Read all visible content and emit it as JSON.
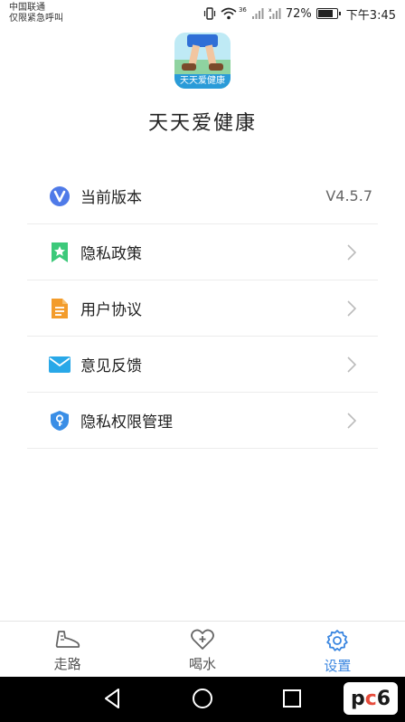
{
  "status_bar": {
    "carrier_line1": "中国联通",
    "carrier_line2": "仅限紧急呼叫",
    "network_small": "36",
    "battery_percent": "72%",
    "battery_level": 0.72,
    "time": "下午3:45"
  },
  "header": {
    "logo_text": "天天爱健康",
    "title": "天天爱健康"
  },
  "menu": {
    "items": [
      {
        "label": "当前版本",
        "value": "V4.5.7",
        "icon": "version-v-icon"
      },
      {
        "label": "隐私政策",
        "icon": "bookmark-star-icon"
      },
      {
        "label": "用户协议",
        "icon": "document-icon"
      },
      {
        "label": "意见反馈",
        "icon": "mail-icon"
      },
      {
        "label": "隐私权限管理",
        "icon": "shield-key-icon"
      }
    ]
  },
  "tabbar": {
    "tabs": [
      {
        "label": "走路",
        "icon": "shoe-icon"
      },
      {
        "label": "喝水",
        "icon": "heart-plus-icon"
      },
      {
        "label": "设置",
        "icon": "gear-icon",
        "active": true
      }
    ]
  },
  "colors": {
    "accent": "#3a86e0",
    "version_icon": "#4f7ae8",
    "privacy_icon": "#3cc97a",
    "agreement_icon": "#f39c2b",
    "feedback_icon": "#29a8e8",
    "permission_icon": "#3a8ee6"
  }
}
